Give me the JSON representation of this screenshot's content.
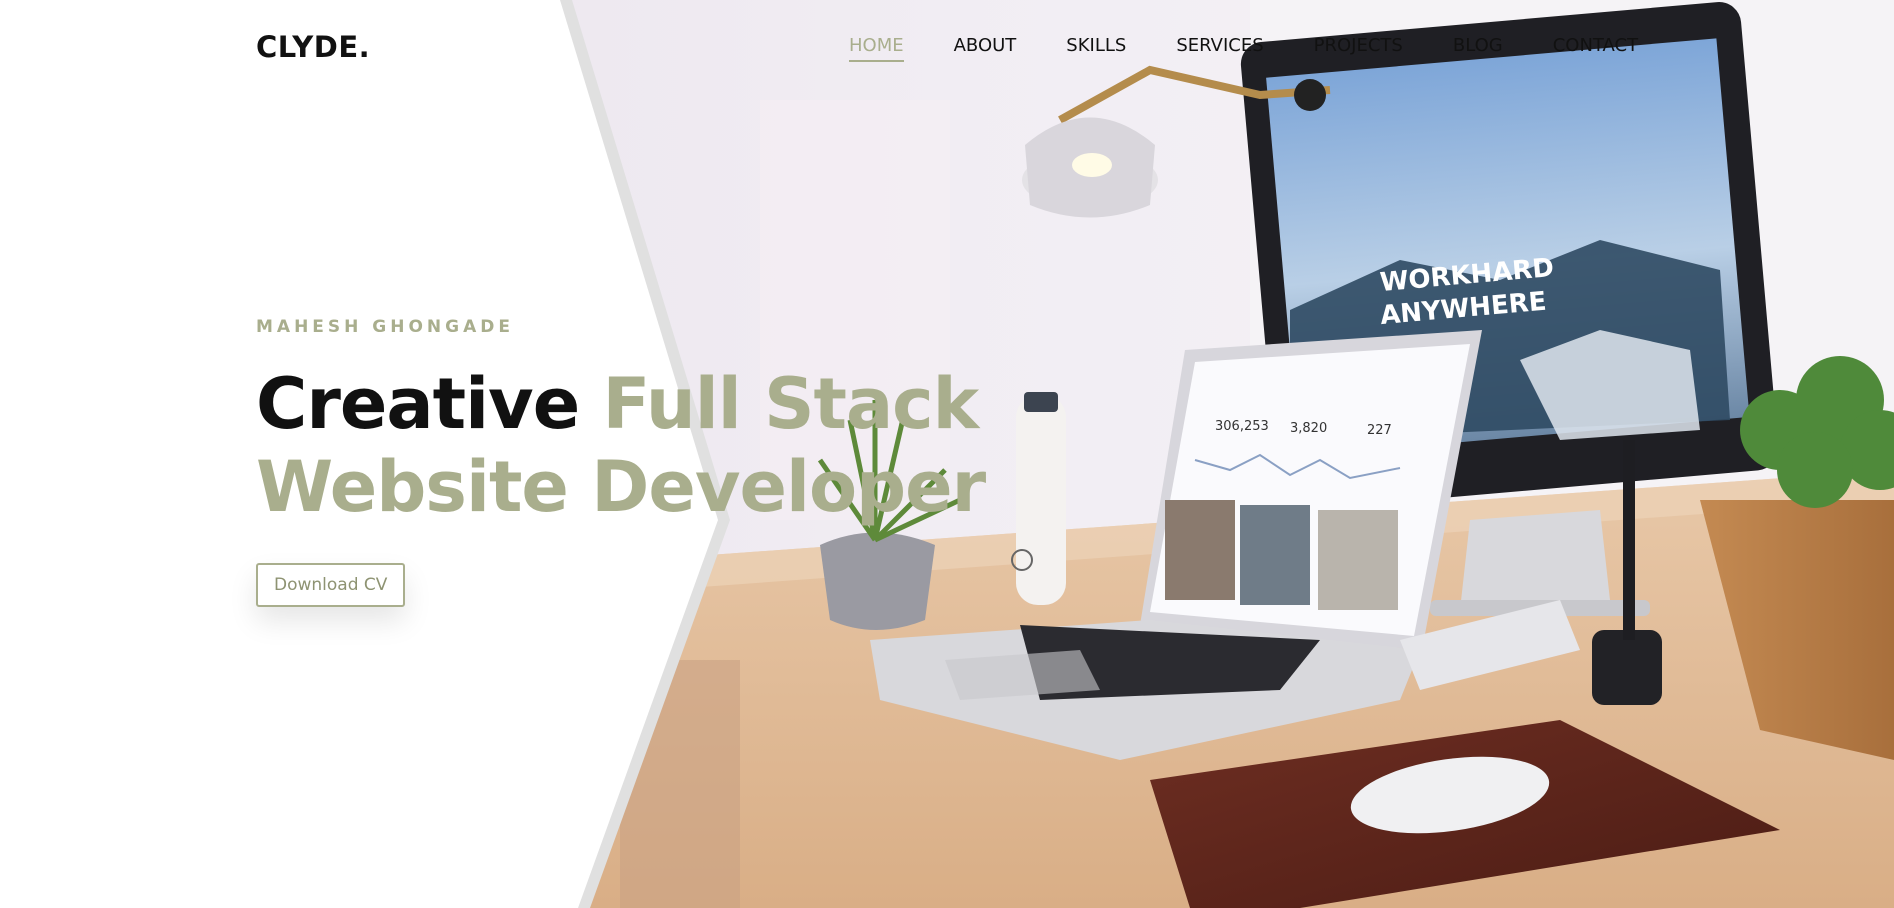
{
  "brand": {
    "logo": "CLYDE."
  },
  "nav": {
    "items": [
      {
        "label": "HOME",
        "active": true
      },
      {
        "label": "ABOUT",
        "active": false
      },
      {
        "label": "SKILLS",
        "active": false
      },
      {
        "label": "SERVICES",
        "active": false
      },
      {
        "label": "PROJECTS",
        "active": false
      },
      {
        "label": "BLOG",
        "active": false
      },
      {
        "label": "CONTACT",
        "active": false
      }
    ]
  },
  "hero": {
    "eyebrow": "MAHESH GHONGADE",
    "headline_part1": "Creative",
    "headline_part2": "Full Stack",
    "headline_part3": "Website Developer",
    "cta_label": "Download CV",
    "photo_text_line1": "WORKHARD",
    "photo_text_line2": "ANYWHERE",
    "stats": [
      "306,253",
      "3,820",
      "227"
    ]
  },
  "colors": {
    "accent": "#a9ae8d",
    "text": "#111111",
    "background": "#ffffff"
  }
}
